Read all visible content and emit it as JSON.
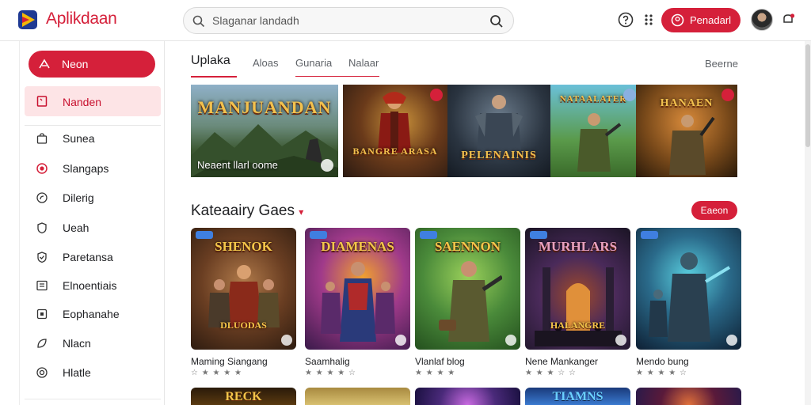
{
  "header": {
    "app_title": "Aplikdaan",
    "search_placeholder": "Slaganar landadh",
    "login_label": "Penadarl"
  },
  "sidebar": {
    "home_label": "Neon",
    "selected_label": "Nanden",
    "items": [
      {
        "label": "Sunea",
        "icon": "bag-icon"
      },
      {
        "label": "Slangaps",
        "icon": "record-icon"
      },
      {
        "label": "Dilerig",
        "icon": "tag-icon"
      },
      {
        "label": "Ueah",
        "icon": "shield-icon"
      },
      {
        "label": "Paretansa",
        "icon": "check-shield-icon"
      },
      {
        "label": "Elnoentiais",
        "icon": "list-icon"
      },
      {
        "label": "Eophanahe",
        "icon": "square-icon"
      },
      {
        "label": "Nlacn",
        "icon": "leaf-icon"
      },
      {
        "label": "Hlatle",
        "icon": "target-icon"
      }
    ]
  },
  "tabs": {
    "items": [
      "Uplaka",
      "Aloas",
      "Gunaria",
      "Nalaar"
    ],
    "active_index": 0,
    "right_label": "Beerne"
  },
  "banner": {
    "caption": "Neaent llarl oome",
    "slides": [
      {
        "title": "MANJUANDAN",
        "scene": "landscape"
      },
      {
        "title": "BANGRE ARASA",
        "scene": "warrior-red"
      },
      {
        "title": "PELENAINIS",
        "scene": "knight-dark"
      },
      {
        "title": "NATAALATER",
        "scene": "soldier-green"
      },
      {
        "title": "HANAEN",
        "scene": "soldier-orange"
      }
    ]
  },
  "category": {
    "heading": "Kateaairy Gaes",
    "all_label": "Eaeon"
  },
  "cards": [
    {
      "title": "SHENOK",
      "subtitle": "DLUODAS",
      "name": "Maming Siangang",
      "stars": "☆ ★ ★ ★ ★",
      "palette": [
        "#7a4a2a",
        "#3a2416"
      ]
    },
    {
      "title": "DIAMENAS",
      "subtitle": "",
      "name": "Saamhalig",
      "stars": "★ ★ ★ ★ ☆",
      "palette": [
        "#8a2a8a",
        "#e07a20"
      ]
    },
    {
      "title": "SAENNON",
      "subtitle": "",
      "name": "Vlanlaf blog",
      "stars": "★ ★ ★ ★",
      "palette": [
        "#3f8a3a",
        "#2a5a24"
      ]
    },
    {
      "title": "MURHLARS",
      "subtitle": "HALANGRE",
      "name": "Nene Mankanger",
      "stars": "★ ★ ★ ☆ ☆",
      "palette": [
        "#4a2a5a",
        "#1e1628"
      ]
    },
    {
      "title": "",
      "subtitle": "",
      "name": "Mendo bung",
      "stars": "★ ★ ★ ★ ☆",
      "palette": [
        "#1a5a6a",
        "#0e2a3a"
      ]
    }
  ],
  "row2": [
    {
      "title": "RECK",
      "palette": [
        "#2a1a0a",
        "#c8a030"
      ]
    },
    {
      "title": "",
      "palette": [
        "#a88a40",
        "#d8c070"
      ]
    },
    {
      "title": "",
      "palette": [
        "#4a2a7a",
        "#1a1040"
      ]
    },
    {
      "title": "TIAMNS",
      "palette": [
        "#1a3a7a",
        "#3a7ad0"
      ]
    },
    {
      "title": "",
      "palette": [
        "#5a1a3a",
        "#2a1a4a"
      ]
    }
  ],
  "colors": {
    "accent": "#d5203a",
    "selected_bg": "#fde4e6"
  }
}
